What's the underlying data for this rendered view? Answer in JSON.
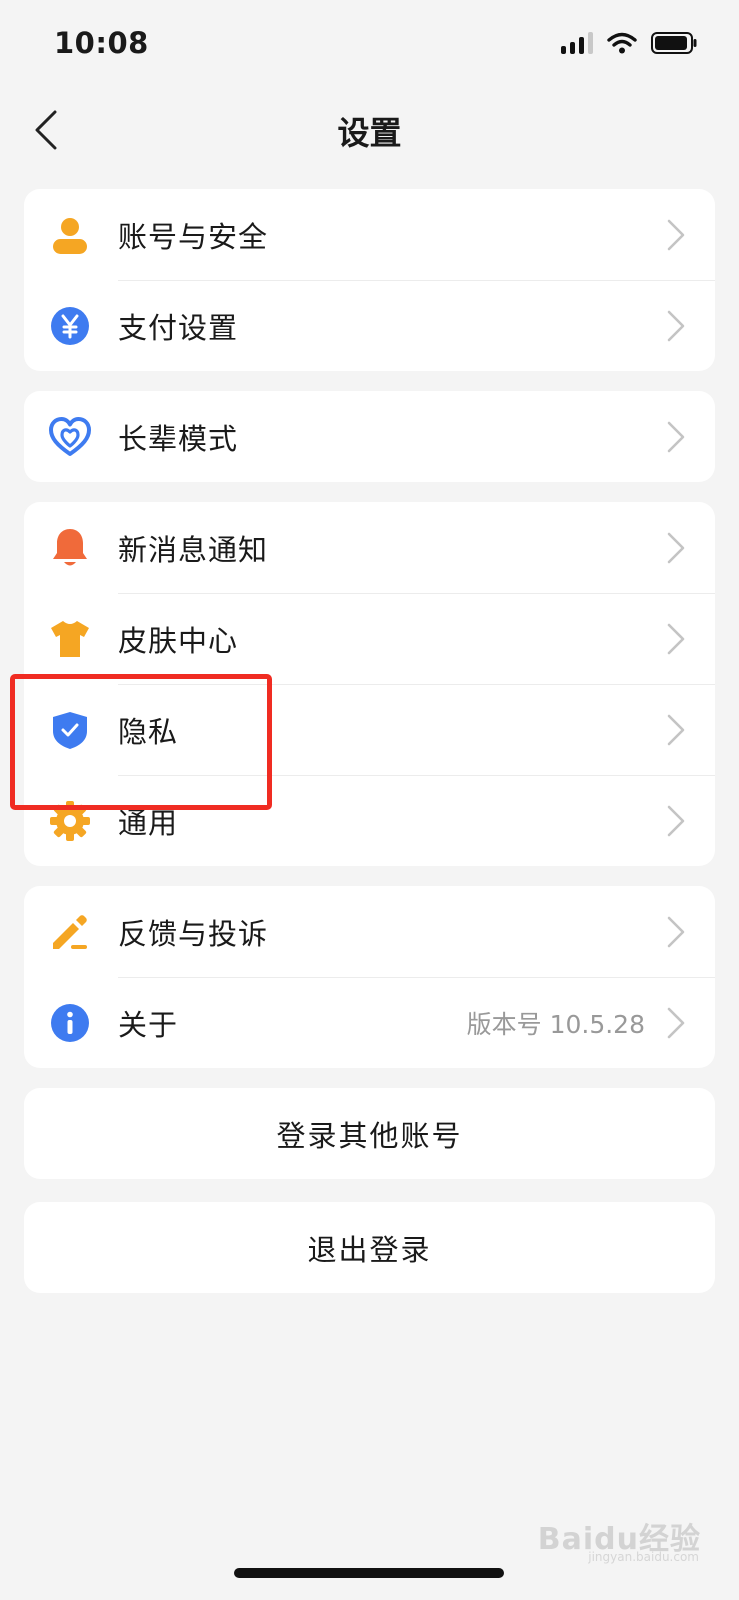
{
  "status_bar": {
    "time": "10:08"
  },
  "nav": {
    "title": "设置"
  },
  "groups": [
    {
      "items": [
        {
          "label": "账号与安全",
          "icon": "user-icon",
          "icon_color": "#f5a623"
        },
        {
          "label": "支付设置",
          "icon": "yuan-icon",
          "icon_color": "#3e7bf0"
        }
      ]
    },
    {
      "items": [
        {
          "label": "长辈模式",
          "icon": "heart-icon",
          "icon_color": "#3e7bf0"
        }
      ]
    },
    {
      "items": [
        {
          "label": "新消息通知",
          "icon": "bell-icon",
          "icon_color": "#f06a3a"
        },
        {
          "label": "皮肤中心",
          "icon": "shirt-icon",
          "icon_color": "#f5a623"
        },
        {
          "label": "隐私",
          "icon": "shield-icon",
          "icon_color": "#3e7bf0",
          "highlighted": true
        },
        {
          "label": "通用",
          "icon": "gear-icon",
          "icon_color": "#f5a623"
        }
      ]
    },
    {
      "items": [
        {
          "label": "反馈与投诉",
          "icon": "pencil-icon",
          "icon_color": "#f5a623"
        },
        {
          "label": "关于",
          "icon": "info-icon",
          "icon_color": "#3e7bf0",
          "value": "版本号 10.5.28"
        }
      ]
    }
  ],
  "actions": {
    "switch_account": "登录其他账号",
    "logout": "退出登录"
  },
  "watermark": {
    "brand": "Baidu经验",
    "url": "jingyan.baidu.com"
  },
  "colors": {
    "background": "#f4f4f4",
    "card": "#ffffff",
    "highlight": "#f02c22",
    "accent_blue": "#3e7bf0",
    "accent_orange": "#f5a623"
  }
}
